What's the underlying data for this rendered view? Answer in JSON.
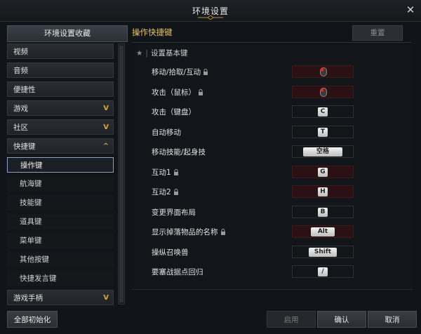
{
  "window": {
    "title": "环境设置",
    "close_icon": "close-icon"
  },
  "sidebar": {
    "header": "环境设置收藏",
    "items": [
      {
        "label": "视频",
        "expandable": false
      },
      {
        "label": "音频",
        "expandable": false
      },
      {
        "label": "便捷性",
        "expandable": false
      },
      {
        "label": "游戏",
        "expandable": true,
        "expanded": false
      },
      {
        "label": "社区",
        "expandable": true,
        "expanded": false
      },
      {
        "label": "快捷键",
        "expandable": true,
        "expanded": true
      },
      {
        "label": "游戏手柄",
        "expandable": true,
        "expanded": false
      }
    ],
    "subitems": [
      {
        "label": "操作键",
        "active": true
      },
      {
        "label": "航海键",
        "active": false
      },
      {
        "label": "技能键",
        "active": false
      },
      {
        "label": "道具键",
        "active": false
      },
      {
        "label": "菜单键",
        "active": false
      },
      {
        "label": "其他按键",
        "active": false
      },
      {
        "label": "快捷发言键",
        "active": false
      }
    ],
    "chevron_down": "V",
    "chevron_up": "^"
  },
  "main": {
    "title": "操作快捷键",
    "reset_label": "重置",
    "section": "设置基本键",
    "accent_color": "#e6c36a",
    "rows": [
      {
        "label": "移动/拾取/互动",
        "locked": true,
        "key": "",
        "mouse": true
      },
      {
        "label": "攻击（鼠标）",
        "locked": true,
        "key": "",
        "mouse": true
      },
      {
        "label": "攻击（键盘）",
        "locked": false,
        "key": "C",
        "mouse": false
      },
      {
        "label": "自动移动",
        "locked": false,
        "key": "T",
        "mouse": false
      },
      {
        "label": "移动技能/起身技",
        "locked": false,
        "key": "空格",
        "mouse": false
      },
      {
        "label": "互动1",
        "locked": true,
        "key": "G",
        "mouse": false
      },
      {
        "label": "互动2",
        "locked": true,
        "key": "H",
        "mouse": false
      },
      {
        "label": "变更界面布局",
        "locked": false,
        "key": "B",
        "mouse": false
      },
      {
        "label": "显示掉落物品的名称",
        "locked": true,
        "key": "Alt",
        "mouse": false
      },
      {
        "label": "操纵召唤兽",
        "locked": false,
        "key": "Shift",
        "mouse": false
      },
      {
        "label": "要塞战据点回归",
        "locked": false,
        "key": "/",
        "mouse": false
      }
    ]
  },
  "footer": {
    "reset_all": "全部初始化",
    "apply": "启用",
    "ok": "确认",
    "cancel": "取消"
  }
}
